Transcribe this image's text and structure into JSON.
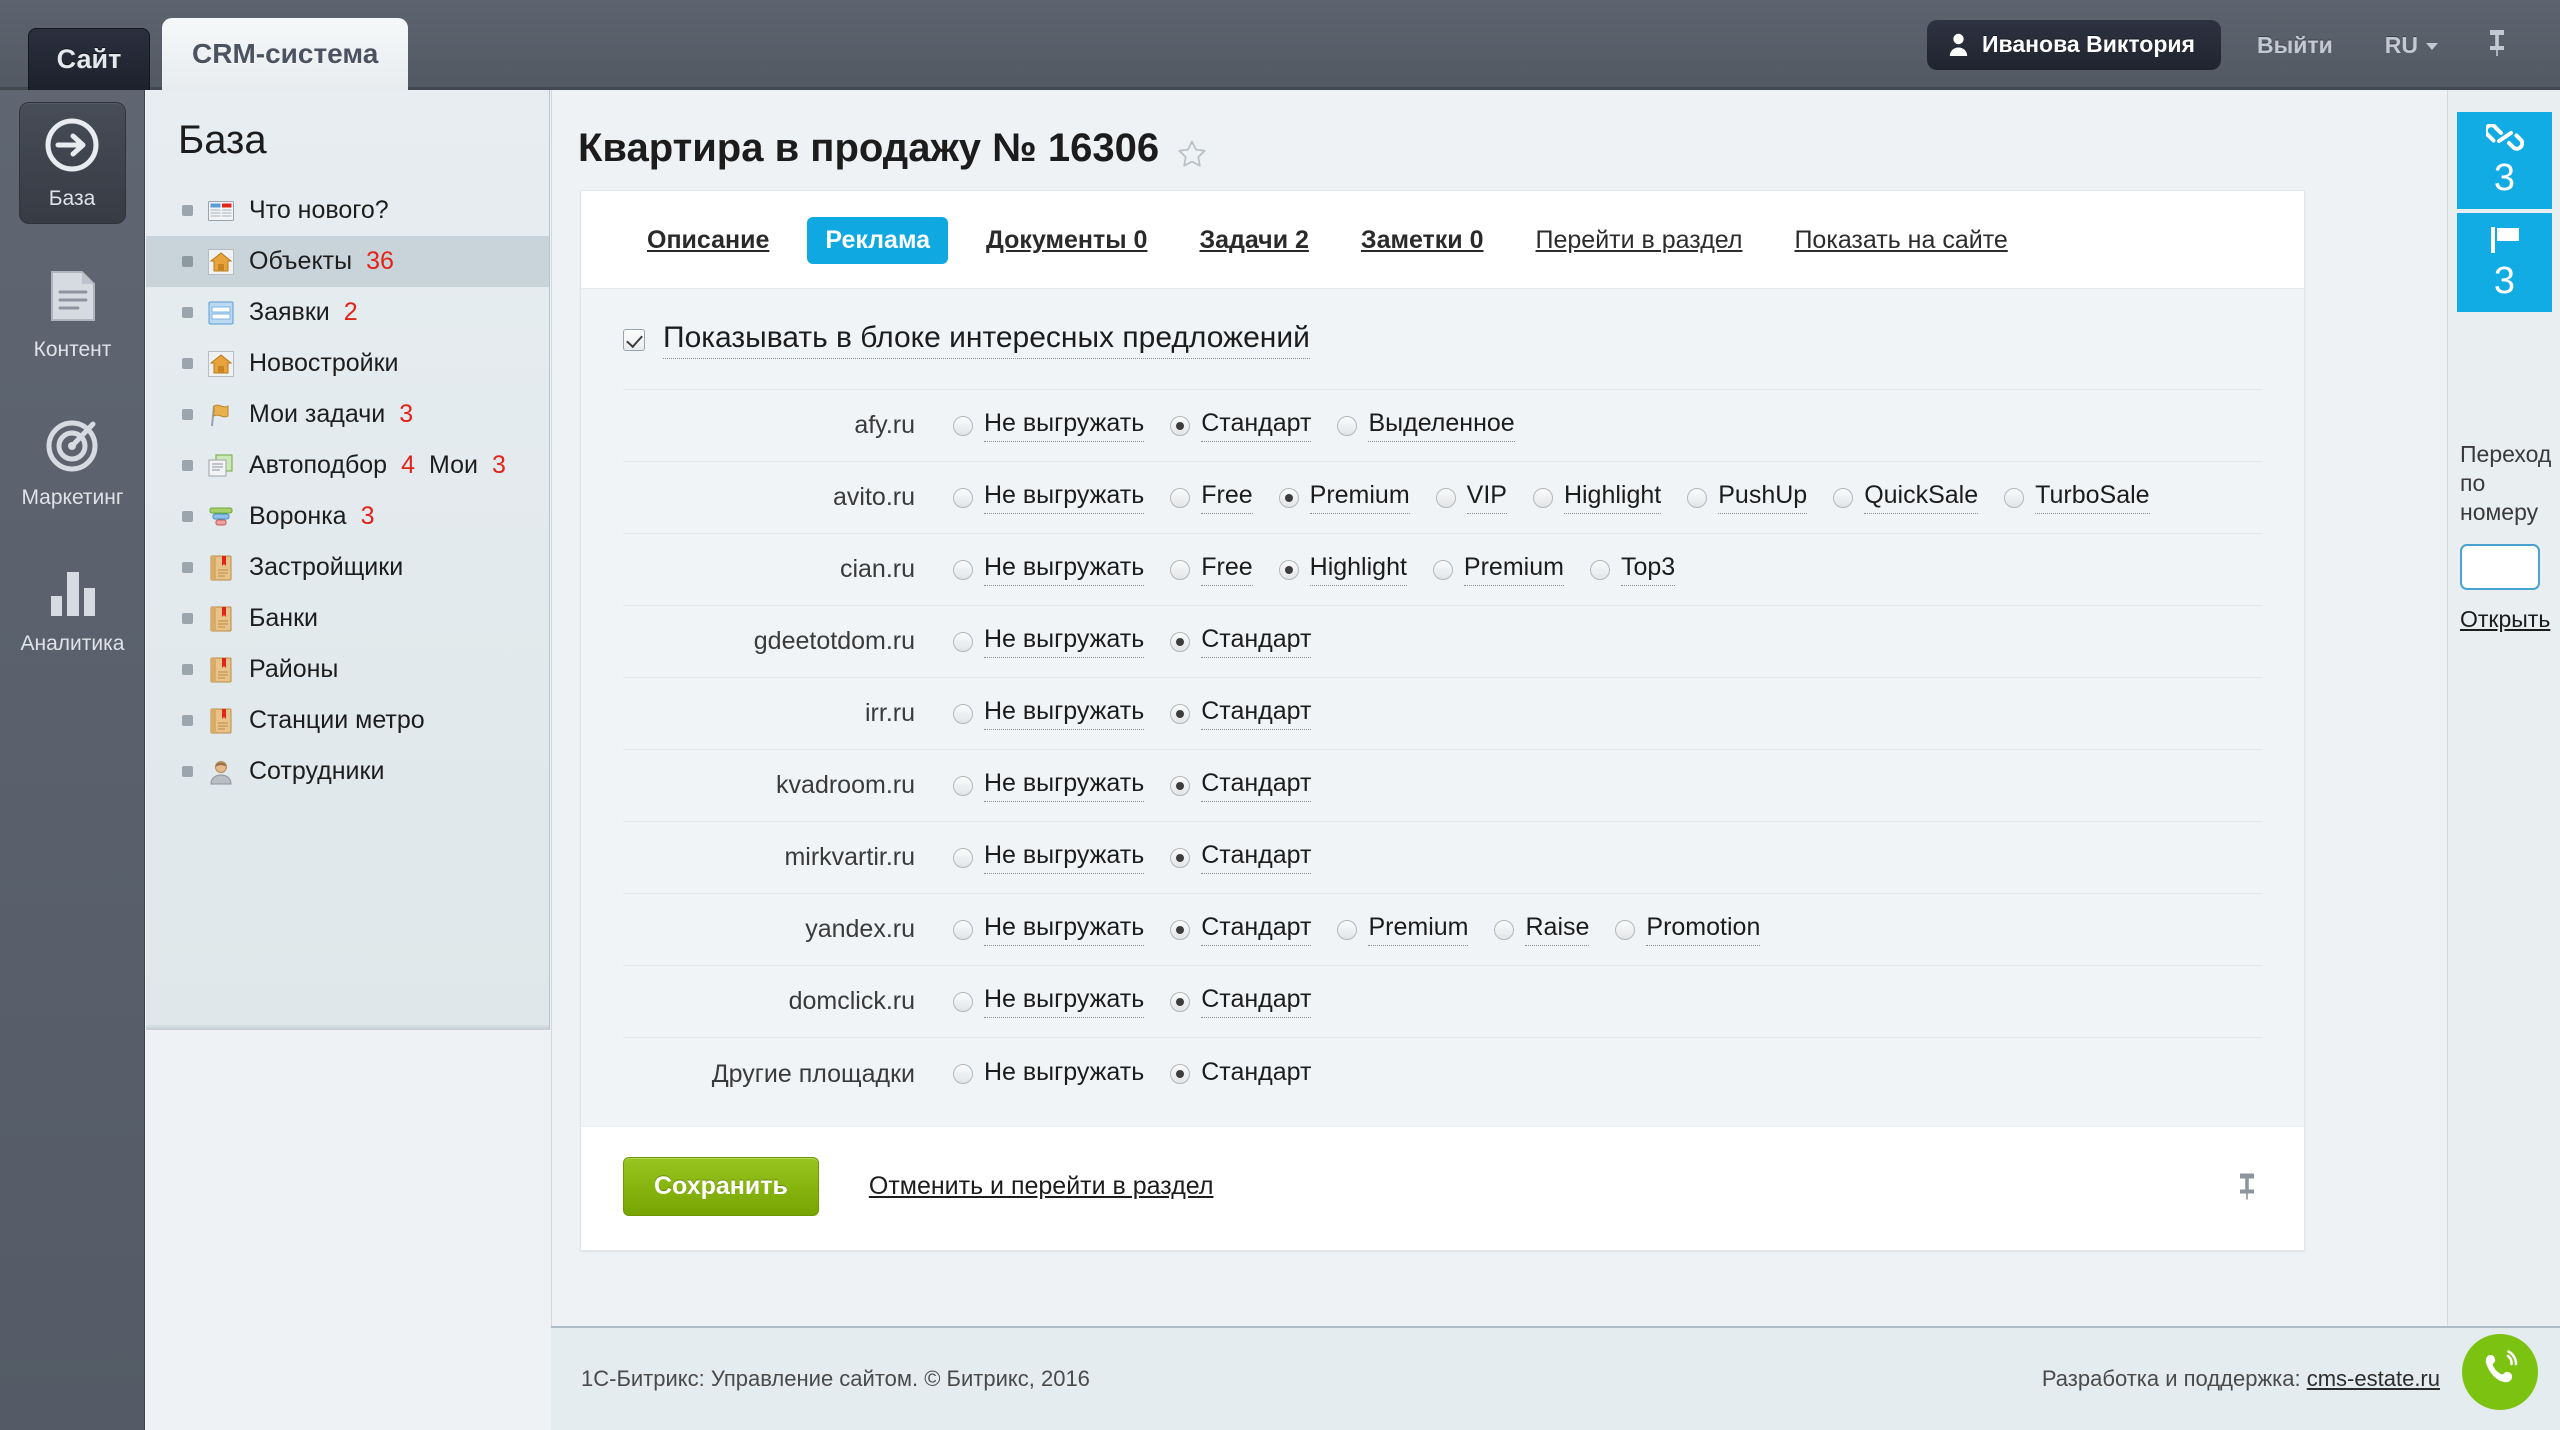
{
  "topbar": {
    "tabs": [
      {
        "label": "Сайт",
        "active": false
      },
      {
        "label": "CRM-система",
        "active": true
      }
    ],
    "user_name": "Иванова Виктория",
    "logout_label": "Выйти",
    "lang_label": "RU",
    "pin_icon": "pin-icon"
  },
  "rail": {
    "items": [
      {
        "label": "База",
        "icon": "arrow-circle-icon",
        "active": true
      },
      {
        "label": "Контент",
        "icon": "document-icon",
        "active": false
      },
      {
        "label": "Маркетинг",
        "icon": "target-icon",
        "active": false
      },
      {
        "label": "Аналитика",
        "icon": "bar-chart-icon",
        "active": false
      }
    ]
  },
  "basemenu": {
    "title": "База",
    "items": [
      {
        "label": "Что нового?",
        "icon": "news-icon",
        "count": "",
        "count2": "",
        "selected": false
      },
      {
        "label": "Объекты",
        "icon": "house-icon",
        "count": "36",
        "count2": "",
        "selected": true
      },
      {
        "label": "Заявки",
        "icon": "form-icon",
        "count": "2",
        "count2": "",
        "selected": false
      },
      {
        "label": "Новостройки",
        "icon": "house-icon",
        "count": "",
        "count2": "",
        "selected": false
      },
      {
        "label": "Мои задачи",
        "icon": "flag-icon",
        "count": "3",
        "count2": "",
        "selected": false
      },
      {
        "label": "Автоподбор",
        "icon": "copy-icon",
        "count": "4",
        "mid": "Мои",
        "count2": "3",
        "selected": false
      },
      {
        "label": "Воронка",
        "icon": "funnel-icon",
        "count": "3",
        "count2": "",
        "selected": false
      },
      {
        "label": "Застройщики",
        "icon": "book-icon",
        "count": "",
        "count2": "",
        "selected": false
      },
      {
        "label": "Банки",
        "icon": "book-icon",
        "count": "",
        "count2": "",
        "selected": false
      },
      {
        "label": "Районы",
        "icon": "book-icon",
        "count": "",
        "count2": "",
        "selected": false
      },
      {
        "label": "Станции метро",
        "icon": "book-icon",
        "count": "",
        "count2": "",
        "selected": false
      },
      {
        "label": "Сотрудники",
        "icon": "user-icon",
        "count": "",
        "count2": "",
        "selected": false
      }
    ]
  },
  "page": {
    "title": "Квартира в продажу № 16306",
    "favorite_icon": "star-icon"
  },
  "tabs": [
    {
      "label": "Описание",
      "style": "link"
    },
    {
      "label": "Реклама",
      "style": "active"
    },
    {
      "label": "Документы 0",
      "style": "link"
    },
    {
      "label": "Задачи 2",
      "style": "link"
    },
    {
      "label": "Заметки 0",
      "style": "link"
    },
    {
      "label": "Перейти в раздел",
      "style": "plain"
    },
    {
      "label": "Показать на сайте",
      "style": "plain"
    }
  ],
  "form": {
    "show_in_block": {
      "label": "Показывать в блоке интересных предложений",
      "checked": true
    },
    "rows": [
      {
        "site": "afy.ru",
        "options": [
          {
            "label": "Не выгружать",
            "selected": false
          },
          {
            "label": "Стандарт",
            "selected": true
          },
          {
            "label": "Выделенное",
            "selected": false
          }
        ]
      },
      {
        "site": "avito.ru",
        "options": [
          {
            "label": "Не выгружать",
            "selected": false
          },
          {
            "label": "Free",
            "selected": false
          },
          {
            "label": "Premium",
            "selected": true
          },
          {
            "label": "VIP",
            "selected": false
          },
          {
            "label": "Highlight",
            "selected": false
          },
          {
            "label": "PushUp",
            "selected": false
          },
          {
            "label": "QuickSale",
            "selected": false
          },
          {
            "label": "TurboSale",
            "selected": false
          }
        ]
      },
      {
        "site": "cian.ru",
        "options": [
          {
            "label": "Не выгружать",
            "selected": false
          },
          {
            "label": "Free",
            "selected": false
          },
          {
            "label": "Highlight",
            "selected": true
          },
          {
            "label": "Premium",
            "selected": false
          },
          {
            "label": "Top3",
            "selected": false
          }
        ]
      },
      {
        "site": "gdeetotdom.ru",
        "options": [
          {
            "label": "Не выгружать",
            "selected": false
          },
          {
            "label": "Стандарт",
            "selected": true
          }
        ]
      },
      {
        "site": "irr.ru",
        "options": [
          {
            "label": "Не выгружать",
            "selected": false
          },
          {
            "label": "Стандарт",
            "selected": true
          }
        ]
      },
      {
        "site": "kvadroom.ru",
        "options": [
          {
            "label": "Не выгружать",
            "selected": false
          },
          {
            "label": "Стандарт",
            "selected": true
          }
        ]
      },
      {
        "site": "mirkvartir.ru",
        "options": [
          {
            "label": "Не выгружать",
            "selected": false
          },
          {
            "label": "Стандарт",
            "selected": true
          }
        ]
      },
      {
        "site": "yandex.ru",
        "options": [
          {
            "label": "Не выгружать",
            "selected": false
          },
          {
            "label": "Стандарт",
            "selected": true
          },
          {
            "label": "Premium",
            "selected": false
          },
          {
            "label": "Raise",
            "selected": false
          },
          {
            "label": "Promotion",
            "selected": false
          }
        ]
      },
      {
        "site": "domclick.ru",
        "options": [
          {
            "label": "Не выгружать",
            "selected": false
          },
          {
            "label": "Стандарт",
            "selected": true
          }
        ]
      },
      {
        "site": "Другие площадки",
        "options": [
          {
            "label": "Не выгружать",
            "selected": false
          },
          {
            "label": "Стандарт",
            "selected": true
          }
        ]
      }
    ],
    "save_label": "Сохранить",
    "cancel_label": "Отменить и перейти в раздел",
    "pin_icon": "pin-icon"
  },
  "rightrail": {
    "badges": [
      {
        "icon": "link-icon",
        "count": "3"
      },
      {
        "icon": "flag-icon",
        "count": "3"
      }
    ],
    "goto_label": "Переход по номеру",
    "goto_value": "",
    "open_label": "Открыть"
  },
  "footer": {
    "left": "1С-Битрикс: Управление сайтом. © Битрикс, 2016",
    "right_prefix": "Разработка и поддержка: ",
    "right_link": "cms-estate.ru",
    "call_icon": "phone-call-icon"
  },
  "colors": {
    "accent_blue": "#12ace4",
    "save_green": "#86b300",
    "count_red": "#e2231a",
    "call_green": "#7bc211"
  }
}
